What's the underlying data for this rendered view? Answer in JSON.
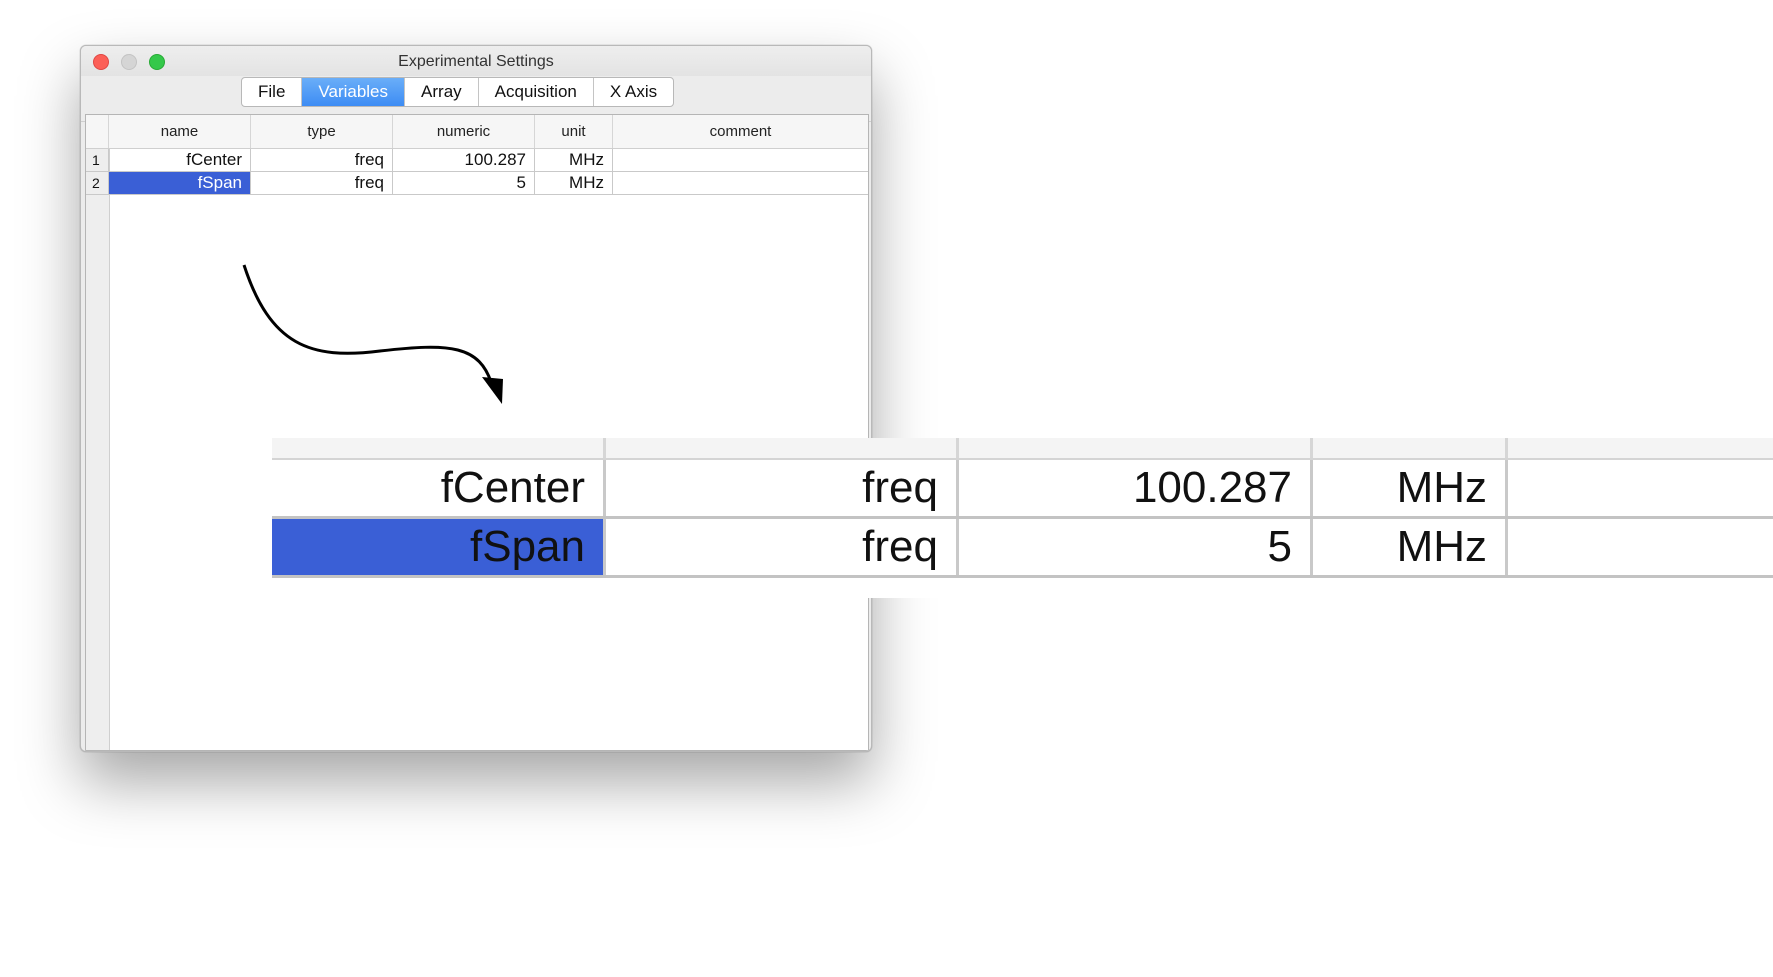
{
  "window": {
    "title": "Experimental Settings"
  },
  "tabs": [
    {
      "label": "File",
      "active": false
    },
    {
      "label": "Variables",
      "active": true
    },
    {
      "label": "Array",
      "active": false
    },
    {
      "label": "Acquisition",
      "active": false
    },
    {
      "label": "X Axis",
      "active": false
    }
  ],
  "table": {
    "headers": [
      "name",
      "type",
      "numeric",
      "unit",
      "comment"
    ],
    "rows": [
      {
        "num": "1",
        "name": "fCenter",
        "type": "freq",
        "numeric": "100.287",
        "unit": "MHz",
        "comment": ""
      },
      {
        "num": "2",
        "name": "fSpan",
        "type": "freq",
        "numeric": "5",
        "unit": "MHz",
        "comment": "",
        "selected": true
      }
    ]
  },
  "colors": {
    "selection": "#3a5fd6",
    "tab_active": "#4a96f6"
  }
}
